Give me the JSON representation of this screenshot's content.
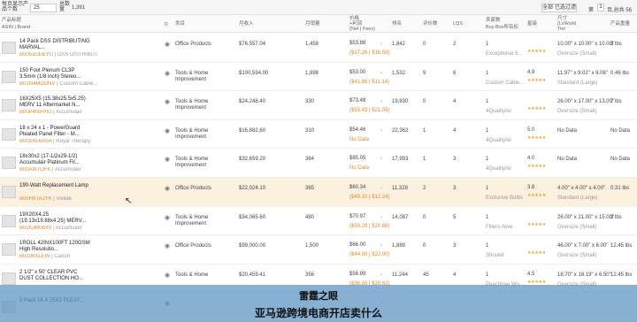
{
  "toolbar": {
    "per_page_label": "每页显示产品个数",
    "per_page_value": "25",
    "total_label": "总数量",
    "total_value": "1,391",
    "filter_label": "全部 已选过滤",
    "page_label": "第",
    "page_value": "1",
    "page_total": "页,总共 56"
  },
  "headers": {
    "product_title": "产品标题",
    "asin_brand": "ASIN | Brand",
    "category": "类目",
    "revenue": "月收入",
    "sales": "月销量",
    "price": "价格",
    "net": "+利润",
    "net_sub": "(Net | Fees)",
    "rank": "排名",
    "reviews": "评价数",
    "lqs": "LQS",
    "sellers": "卖家数",
    "buybox": "Buy Box所有权",
    "rating": "星级",
    "size": "尺寸",
    "lwh": "(LxWxH)",
    "tier": "Tier",
    "weight": "产品重量"
  },
  "rows": [
    {
      "title": "14 Pack DSS DISTRIBUTING MARVAL...",
      "asin": "B0053UEEYU",
      "brand": "DSS DISTRIBUT...",
      "category": "Office Products",
      "revenue": "$76,557.04",
      "sales": "1,458",
      "price": "$53.88",
      "price2": "($37.26 | $16.59)",
      "rank": "1,842",
      "reviews": "0",
      "lqs": "2",
      "sellers": "1",
      "seller2": "Exceptional S...",
      "rating": "",
      "stars": "★★★★★",
      "nodata": "",
      "dims": "10.00\" x 10.00\" x 10.00\"",
      "tier": "Oversize (Small)",
      "weight": "3 lbs",
      "hl": false
    },
    {
      "title": "150 Foot Plenum CL3P 3.5mm (1/8 inch) Stereo...",
      "asin": "B01N4MDDNV",
      "brand": "Custom Cable...",
      "category": "Tools & Home Improvement",
      "revenue": "$100,594.00",
      "sales": "1,898",
      "price": "$53.00",
      "price2": "($41.86 | $11.14)",
      "rank": "1,532",
      "reviews": "9",
      "lqs": "6",
      "sellers": "1",
      "seller2": "Custom Cable...",
      "rating": "4.9",
      "stars": "★★★★★",
      "nodata": "",
      "dims": "11.97\" x 9.02\" x 9.06\"",
      "tier": "Standard (Large)",
      "weight": "0.46 lbs",
      "hl": false
    },
    {
      "title": "16X25X5 (15.38x25.5x5.25) MERV 11 Aftermarket N...",
      "asin": "B00P4NPPIU",
      "brand": "Accumulair",
      "category": "Tools & Home Improvement",
      "revenue": "$24,248.40",
      "sales": "330",
      "price": "$73.48",
      "price2": "($53.43 | $21.05)",
      "rank": "19,830",
      "reviews": "0",
      "lqs": "4",
      "sellers": "1",
      "seller2": "4QualityAir",
      "rating": "",
      "stars": "★★★★★",
      "nodata": "",
      "dims": "26.00\" x 17.00\" x 13.00\"",
      "tier": "Oversize (Small)",
      "weight": "7 lbs",
      "hl": false
    },
    {
      "title": "18 x 24 x 1 - PowerGuard Pleated Panel Filter - M...",
      "asin": "B005XE6A5A",
      "brand": "Royal Therapy",
      "category": "Tools & Home Improvement",
      "revenue": "$16,882.60",
      "sales": "310",
      "price": "$54.46",
      "price2": "No Data",
      "rank": "22,362",
      "reviews": "1",
      "lqs": "4",
      "sellers": "1",
      "seller2": "4QualityAir",
      "rating": "5.0",
      "stars": "★★★★★",
      "nodata": "",
      "dims": "No Data",
      "tier": "",
      "weight": "No Data",
      "hl": false
    },
    {
      "title": "18x30x2 (17-1/2x29-1/2) Accumulair Platinum Fil...",
      "asin": "B00A9I7OFK",
      "brand": "Accumulair",
      "category": "Tools & Home Improvement",
      "revenue": "$32,659.20",
      "sales": "384",
      "price": "$85.05",
      "price2": "No Data",
      "rank": "17,993",
      "reviews": "1",
      "lqs": "3",
      "sellers": "1",
      "seller2": "4QualityAir",
      "rating": "4.0",
      "stars": "★★★★★",
      "nodata": "",
      "dims": "No Data",
      "tier": "",
      "weight": "No Data",
      "hl": false
    },
    {
      "title": "190-Watt Replacement Lamp",
      "asin": "B00H9TAJYK",
      "brand": "Vivitek",
      "category": "Office Products",
      "revenue": "$22,024.10",
      "sales": "365",
      "price": "$60.34",
      "price2": "($48.10 | $12.24)",
      "rank": "11,328",
      "reviews": "2",
      "lqs": "3",
      "sellers": "1",
      "seller2": "Exclusive Bulbs",
      "rating": "3.8",
      "stars": "★★★★★",
      "nodata": "",
      "dims": "4.00\" x 4.00\" x 4.00\"",
      "tier": "Standard (Large)",
      "weight": "0.31 lbs",
      "hl": true
    },
    {
      "title": "19X20X4.25 (19.13x19.88x4.25) MERV...",
      "asin": "B00IUBK6RS",
      "brand": "Accumulair",
      "category": "Tools & Home Improvement",
      "revenue": "$34,065.60",
      "sales": "480",
      "price": "$70.97",
      "price2": "($50.29 | $20.68)",
      "rank": "14,087",
      "reviews": "0",
      "lqs": "5",
      "sellers": "1",
      "seller2": "Filters-Now",
      "rating": "",
      "stars": "★★★★★",
      "nodata": "",
      "dims": "26.00\" x 21.00\" x 15.00\"",
      "tier": "Oversize (Small)",
      "weight": "3 lbs",
      "hl": false
    },
    {
      "title": "1ROLL 42INX100FT 120GSM High Resolutio...",
      "asin": "B0196XLEW",
      "brand": "Canon",
      "category": "Office Products",
      "revenue": "$99,000.00",
      "sales": "1,500",
      "price": "$66.00",
      "price2": "($44.00 | $22.00)",
      "rank": "1,889",
      "reviews": "0",
      "lqs": "3",
      "sellers": "1",
      "seller2": "Shoulet",
      "rating": "",
      "stars": "★★★★★",
      "nodata": "",
      "dims": "46.00\" x 7.00\" x 6.00\"",
      "tier": "Oversize (Small)",
      "weight": "12.45 lbs",
      "hl": false
    },
    {
      "title": "2 1/2\" x 50' CLEAR PVC DUST COLLECTION HO...",
      "asin": "",
      "brand": "",
      "category": "Tools & Home",
      "revenue": "$20,459.41",
      "sales": "356",
      "price": "$56.99",
      "price2": "($36.38 | $20.61)",
      "rank": "11,244",
      "reviews": "45",
      "lqs": "4",
      "sellers": "1",
      "seller2": "Peachtree Wo...",
      "rating": "4.5",
      "stars": "★★★★★",
      "nodata": "",
      "dims": "18.70\" x 18.19\" x 6.50\"",
      "tier": "Oversize (Small)",
      "weight": "12.45 lbs",
      "hl": false
    },
    {
      "title": "2 Pack 16 X 25X1 PLEAT...",
      "asin": "",
      "brand": "",
      "category": "",
      "revenue": "",
      "sales": "",
      "price": "",
      "price2": "",
      "rank": "",
      "reviews": "",
      "lqs": "",
      "sellers": "",
      "seller2": "",
      "rating": "",
      "stars": "",
      "nodata": "",
      "dims": "",
      "tier": "",
      "weight": "",
      "hl": false
    }
  ],
  "watermark": {
    "line1": "雷霆之眼",
    "line2": "亚马逊跨境电商开店卖什么"
  }
}
